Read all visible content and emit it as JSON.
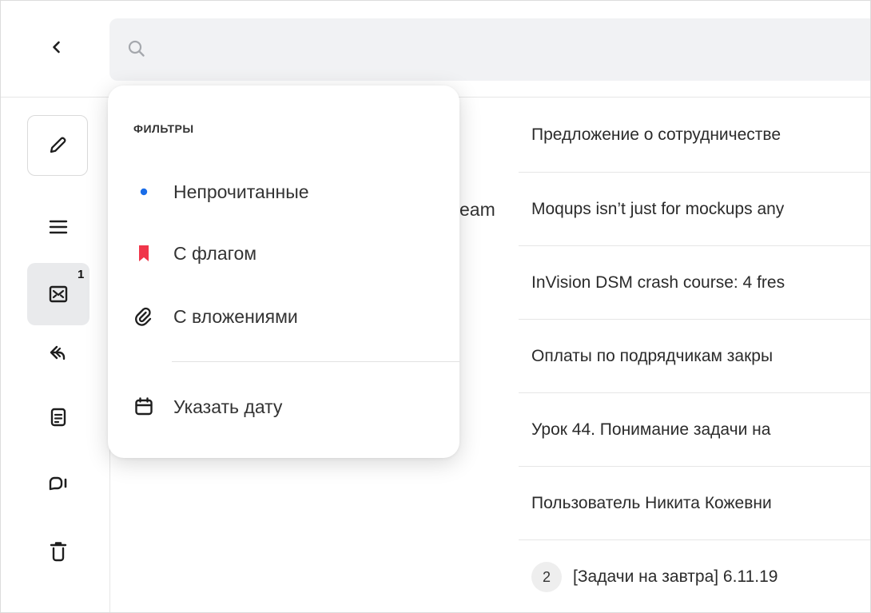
{
  "search": {
    "placeholder": "",
    "value": ""
  },
  "sidebar": {
    "inbox_badge": "1",
    "items": [
      {
        "icon": "menu-icon"
      },
      {
        "icon": "inbox-icon"
      },
      {
        "icon": "sent-icon"
      },
      {
        "icon": "drafts-icon"
      },
      {
        "icon": "spam-icon"
      },
      {
        "icon": "trash-icon"
      }
    ]
  },
  "partial_sender": "eam",
  "filters": {
    "title": "ФИЛЬТРЫ",
    "unread_label": "Непрочитанные",
    "flagged_label": "С флагом",
    "attachments_label": "С вложениями",
    "date_label": "Указать дату",
    "colors": {
      "unread_dot": "#1a6de8",
      "flag": "#f0364a"
    }
  },
  "messages": [
    {
      "subject": "Предложение о сотрудничестве"
    },
    {
      "subject": "Moqups isn’t just for mockups any"
    },
    {
      "subject": "InVision DSM crash course: 4 fres"
    },
    {
      "subject": "Оплаты по подрядчикам закры"
    },
    {
      "subject": "Урок 44. Понимание задачи на"
    },
    {
      "subject": "Пользователь Никита Кожевни"
    },
    {
      "subject": "[Задачи на завтра] 6.11.19",
      "count": "2"
    }
  ]
}
